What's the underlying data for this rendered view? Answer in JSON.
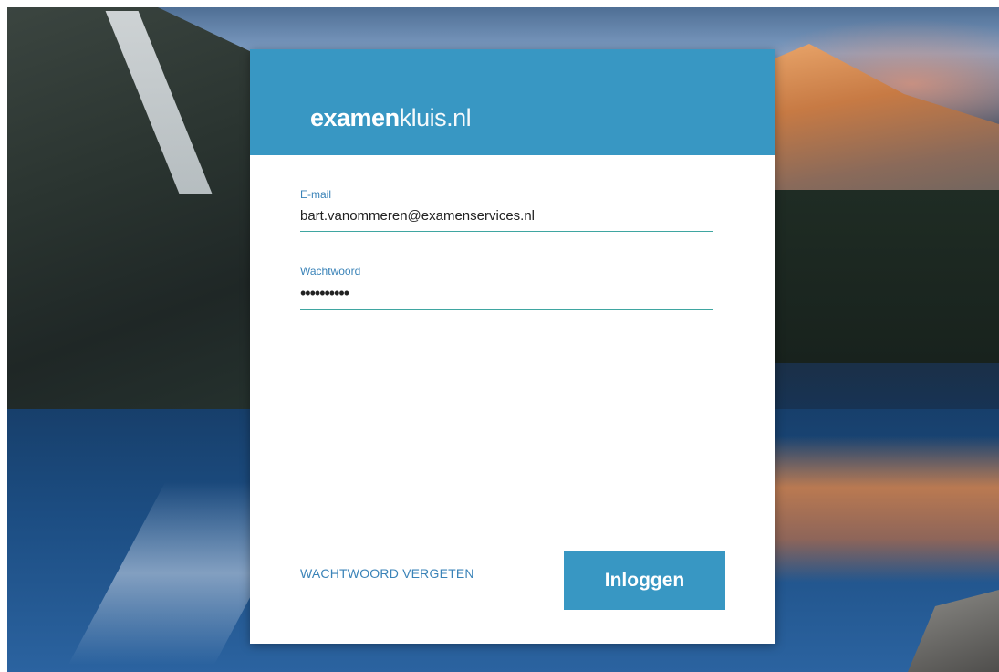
{
  "logo": {
    "bold": "examen",
    "light": "kluis.nl"
  },
  "form": {
    "email": {
      "label": "E-mail",
      "value": "bart.vanommeren@examenservices.nl"
    },
    "password": {
      "label": "Wachtwoord",
      "value": "••••••••••"
    }
  },
  "actions": {
    "forgot_label": "WACHTWOORD VERGETEN",
    "login_label": "Inloggen"
  },
  "colors": {
    "accent": "#3897c3",
    "underline": "#3fa6a1",
    "label": "#3a83b8"
  }
}
